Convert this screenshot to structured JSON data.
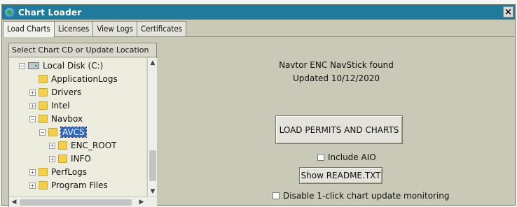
{
  "window": {
    "title": "Chart Loader",
    "close_label": "×"
  },
  "tabs": [
    {
      "label": "Load Charts",
      "active": true
    },
    {
      "label": "Licenses",
      "active": false
    },
    {
      "label": "View Logs",
      "active": false
    },
    {
      "label": "Certificates",
      "active": false
    }
  ],
  "left_panel": {
    "header": "Select Chart CD or Update Location",
    "tree": [
      {
        "label": "Local Disk (C:)",
        "expander": "−",
        "icon": "disk-icon"
      },
      {
        "label": "ApplicationLogs",
        "expander": "",
        "icon": "folder-icon"
      },
      {
        "label": "Drivers",
        "expander": "+",
        "icon": "folder-icon"
      },
      {
        "label": "Intel",
        "expander": "+",
        "icon": "folder-icon"
      },
      {
        "label": "Navbox",
        "expander": "−",
        "icon": "folder-icon"
      },
      {
        "label": "AVCS",
        "expander": "−",
        "icon": "folder-icon",
        "selected": true
      },
      {
        "label": "ENC_ROOT",
        "expander": "+",
        "icon": "folder-icon"
      },
      {
        "label": "INFO",
        "expander": "+",
        "icon": "folder-icon"
      },
      {
        "label": "PerfLogs",
        "expander": "+",
        "icon": "folder-icon"
      },
      {
        "label": "Program Files",
        "expander": "+",
        "icon": "folder-icon"
      }
    ]
  },
  "right_panel": {
    "device_status": "Navtor ENC NavStick found",
    "updated_text": "Updated 10/12/2020",
    "load_button": "LOAD PERMITS AND CHARTS",
    "include_aio": "Include AIO",
    "readme_button": "Show README.TXT",
    "disable_monitoring": "Disable 1-click chart update monitoring"
  },
  "colors": {
    "titlebar": "#1f7a9b",
    "selection": "#3068c4",
    "panel_bg": "#c9c9b7"
  }
}
